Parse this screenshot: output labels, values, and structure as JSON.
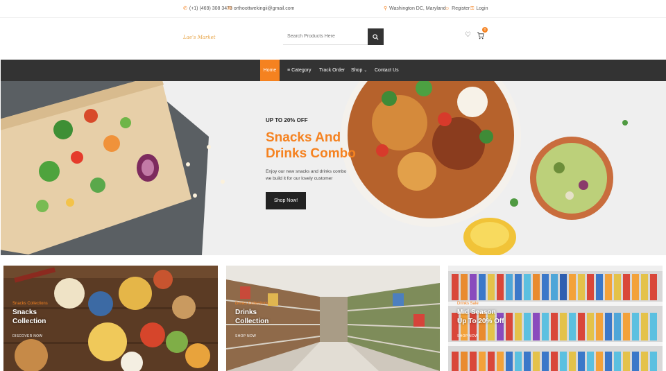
{
  "topbar": {
    "phone": "(+1) (469) 308 3473",
    "email": "orthoottwekingii@gmail.com",
    "location": "Washington DC, Maryland",
    "register": "Register",
    "login": "Login"
  },
  "header": {
    "logo": "Lae's Market",
    "search_placeholder": "Search Products Here",
    "cart_count": "0"
  },
  "nav": {
    "items": [
      "Home",
      "Category",
      "Track Order",
      "Shop",
      "Contact Us"
    ]
  },
  "hero": {
    "kicker": "UP TO 20% OFF",
    "title_line1": "Snacks And",
    "title_line2": "Drinks Combo",
    "desc_line1": "Enjoy our new snacks and drinks combo",
    "desc_line2": "we build it for our lovely customer",
    "button": "Shop Now!"
  },
  "cards": [
    {
      "kicker": "Snacks Collections",
      "title_line1": "Snacks",
      "title_line2": "Collection",
      "link": "DISCOVER NOW"
    },
    {
      "kicker": "Drinks Collections",
      "title_line1": "Drinks",
      "title_line2": "Collection",
      "link": "SHOP NOW"
    },
    {
      "kicker": "Drinks Sale",
      "title_line1": "Mid Season",
      "title_line2": "Up To 20% Off",
      "link": "SHOP NOW"
    }
  ],
  "colors": {
    "accent": "#f58220",
    "nav_bg": "#333333",
    "dark_button": "#222222"
  },
  "icons": [
    "phone-icon",
    "mail-icon",
    "location-icon",
    "user-icon",
    "lock-icon",
    "search-icon",
    "heart-icon",
    "cart-icon",
    "chevron-down-icon",
    "grid-icon"
  ]
}
